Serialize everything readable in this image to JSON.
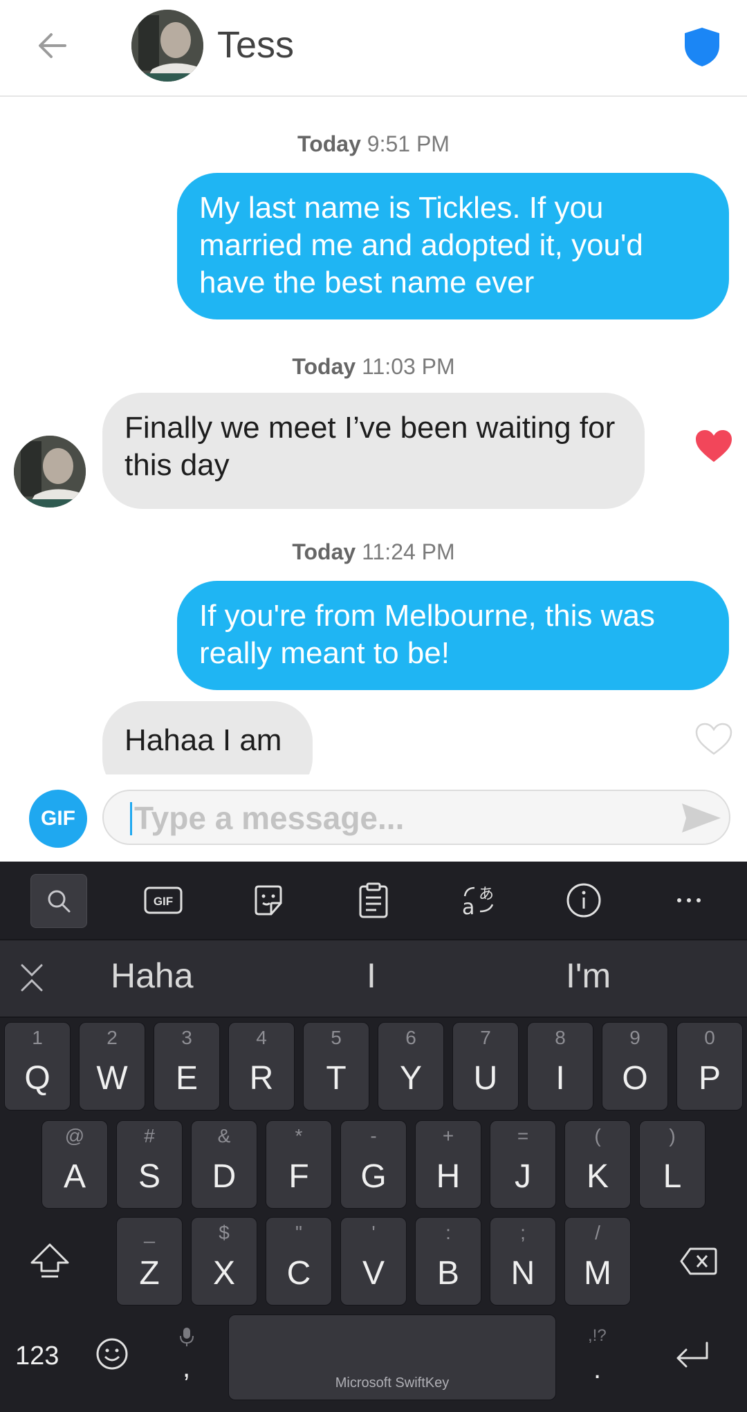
{
  "header": {
    "contact_name": "Tess",
    "back_icon": "arrow-left-icon",
    "safety_icon": "shield-icon",
    "shield_color": "#1b86f5"
  },
  "messages": [
    {
      "type": "timestamp",
      "day": "Today",
      "time": "9:51 PM"
    },
    {
      "type": "outgoing",
      "text": "My last name is Tickles. If you married me and adopted it, you'd have the best name ever"
    },
    {
      "type": "timestamp",
      "day": "Today",
      "time": "11:03 PM"
    },
    {
      "type": "incoming",
      "text": "Finally we meet I’ve been waiting for this day",
      "liked": true
    },
    {
      "type": "timestamp",
      "day": "Today",
      "time": "11:24 PM"
    },
    {
      "type": "outgoing",
      "text": "If you're from Melbourne, this was really meant to be!"
    },
    {
      "type": "incoming",
      "text": "Hahaa I am",
      "liked": false
    }
  ],
  "composer": {
    "gif_label": "GIF",
    "placeholder": "Type a message...",
    "send_icon": "send-icon"
  },
  "keyboard": {
    "toolbar": [
      "search-icon",
      "gif-icon",
      "sticker-icon",
      "clipboard-icon",
      "translate-icon",
      "info-icon",
      "more-icon"
    ],
    "toolbar_gif_label": "GIF",
    "suggestions": [
      "Haha",
      "I",
      "I'm"
    ],
    "rows": [
      [
        [
          "Q",
          "1"
        ],
        [
          "W",
          "2"
        ],
        [
          "E",
          "3"
        ],
        [
          "R",
          "4"
        ],
        [
          "T",
          "5"
        ],
        [
          "Y",
          "6"
        ],
        [
          "U",
          "7"
        ],
        [
          "I",
          "8"
        ],
        [
          "O",
          "9"
        ],
        [
          "P",
          "0"
        ]
      ],
      [
        [
          "A",
          "@"
        ],
        [
          "S",
          "#"
        ],
        [
          "D",
          "&"
        ],
        [
          "F",
          "*"
        ],
        [
          "G",
          "-"
        ],
        [
          "H",
          "+"
        ],
        [
          "J",
          "="
        ],
        [
          "K",
          "("
        ],
        [
          "L",
          ")"
        ]
      ],
      [
        [
          "Z",
          "_"
        ],
        [
          "X",
          "$"
        ],
        [
          "C",
          "\""
        ],
        [
          "V",
          "'"
        ],
        [
          "B",
          ":"
        ],
        [
          "N",
          ";"
        ],
        [
          "M",
          "/"
        ]
      ]
    ],
    "numbers_label": "123",
    "comma_label": ",",
    "period_label": ".",
    "punct_hint": ",!?",
    "space_label": "Microsoft SwiftKey"
  },
  "colors": {
    "outgoing_bubble": "#1fb5f3",
    "incoming_bubble": "#e8e8e8",
    "like_active": "#f2465a",
    "keyboard_bg": "#1f1f24"
  }
}
